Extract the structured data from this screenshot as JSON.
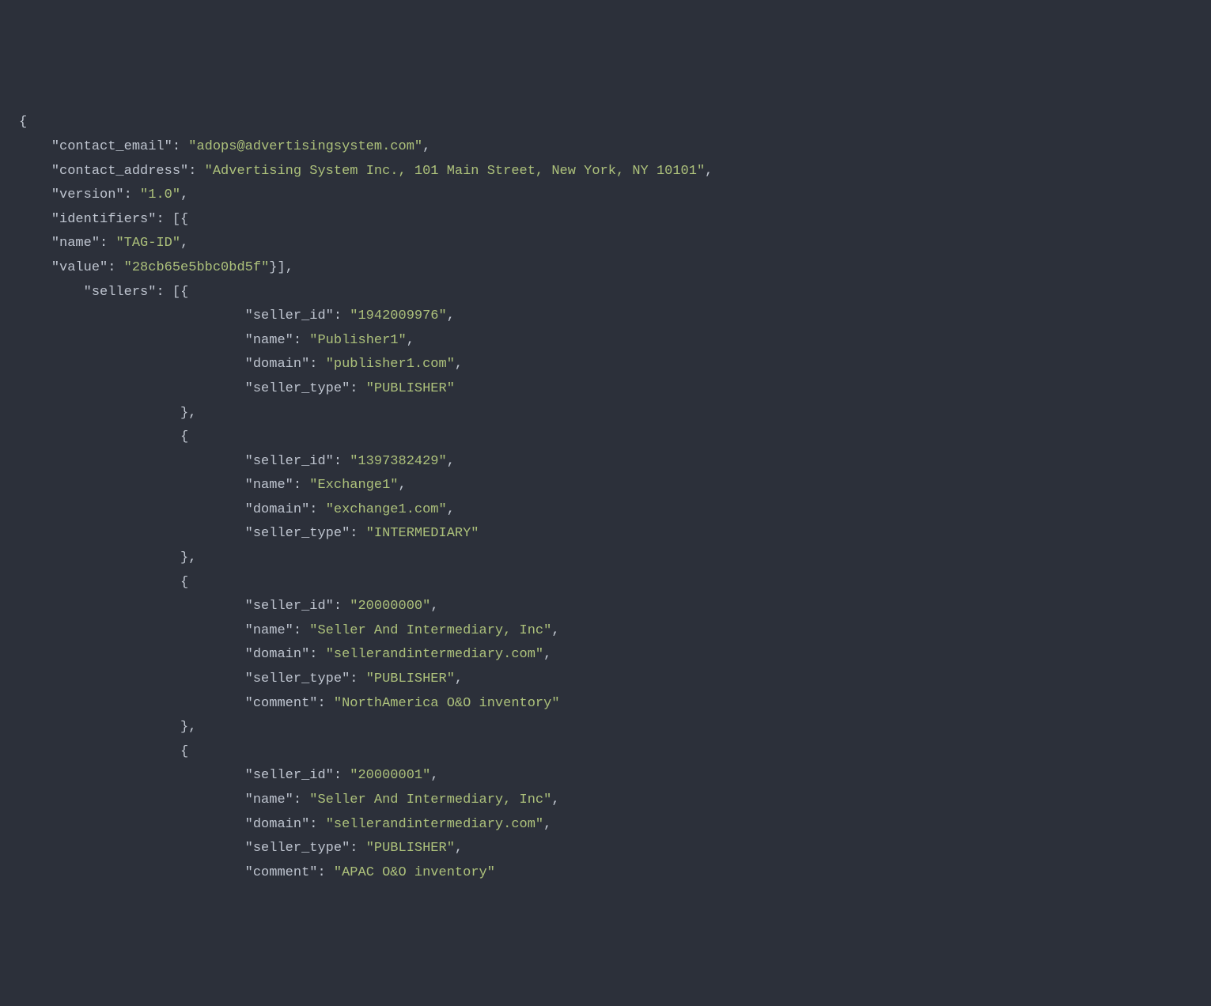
{
  "punct": {
    "open_brace": "{",
    "close_brace": "}",
    "open_bracket": "[",
    "close_bracket": "]",
    "comma": ",",
    "colon": ":",
    "quote": "\""
  },
  "keys": {
    "contact_email": "contact_email",
    "contact_address": "contact_address",
    "version": "version",
    "identifiers": "identifiers",
    "name": "name",
    "value": "value",
    "sellers": "sellers",
    "seller_id": "seller_id",
    "domain": "domain",
    "seller_type": "seller_type",
    "comment": "comment"
  },
  "vals": {
    "contact_email": "adops@advertisingsystem.com",
    "contact_address": "Advertising System Inc., 101 Main Street, New York, NY 10101",
    "version": "1.0",
    "identifier_name": "TAG-ID",
    "identifier_value": "28cb65e5bbc0bd5f",
    "s1_id": "1942009976",
    "s1_name": "Publisher1",
    "s1_domain": "publisher1.com",
    "s1_type": "PUBLISHER",
    "s2_id": "1397382429",
    "s2_name": "Exchange1",
    "s2_domain": "exchange1.com",
    "s2_type": "INTERMEDIARY",
    "s3_id": "20000000",
    "s3_name": "Seller And Intermediary, Inc",
    "s3_domain": "sellerandintermediary.com",
    "s3_type": "PUBLISHER",
    "s3_comment": "NorthAmerica O&O inventory",
    "s4_id": "20000001",
    "s4_name": "Seller And Intermediary, Inc",
    "s4_domain": "sellerandintermediary.com",
    "s4_type": "PUBLISHER",
    "s4_comment": "APAC O&O inventory"
  }
}
